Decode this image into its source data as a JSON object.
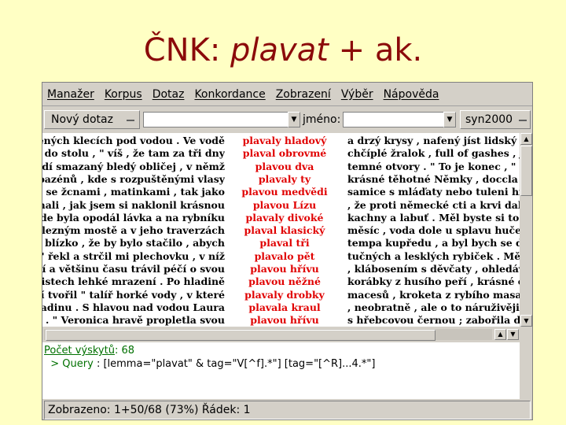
{
  "slide": {
    "title_prefix": "ČNK: ",
    "title_italic": "plavat",
    "title_suffix": " + ak."
  },
  "menubar": {
    "items": [
      "Manažer",
      "Korpus",
      "Dotaz",
      "Konkordance",
      "Zobrazení",
      "Výběr",
      "Nápověda"
    ]
  },
  "toolbar": {
    "new_query_label": "Nový dotaz",
    "query_input_value": "",
    "name_label": "jméno:",
    "name_input_value": "",
    "corpus_label": "syn2000"
  },
  "concordance": {
    "rows": [
      {
        "left": "ěvěných klecích pod vodou . Ve vodě",
        "kwic": "plavaly hladový",
        "right": "a drzý krysy , nafený jíst lidský m"
      },
      {
        "left": "lední do stolu , \" víš , že tam za tři dny",
        "kwic": "plaval obrovmé",
        "right": "chčíplé žralok , full of gashes , jak s"
      },
      {
        "left": "p vidí smazaný bledý obličej , v němž",
        "kwic": "plavou dva",
        "right": "temné otvory . \" To je konec , \" sly"
      },
      {
        "left": "vali bazénů , kde s rozpuštěnými vlasy",
        "kwic": "plavaly ty",
        "right": "krásné těhotné Němky , doccla nat"
      },
      {
        "left": "avali se žcnami , matinkami , tak jako",
        "kwic": "plavou medvědi",
        "right": "samice s mláďaty nebo tuleni hnco"
      },
      {
        "left": "poznali , jak jsem si naklonil krásnou",
        "kwic": "plavou Lízu",
        "right": ", že proti německé cti a krvi dala pi"
      },
      {
        "left": "a , kde byla opodál lávka a na rybníku",
        "kwic": "plavaly divoké",
        "right": "kachny a labuť . Měl byste si to par"
      },
      {
        "left": "a železným mostě a v jeho traverzách",
        "kwic": "plaval klasický",
        "right": "měsíc , voda dole u splavu hučela a"
      },
      {
        "left": "tak blízko , že by bylo stačilo , abych",
        "kwic": "plaval tři",
        "right": "tempa kupředu , a byl bych se dotýl"
      },
      {
        "left": "a \" řekl a strčil mi plechovku , v níž",
        "kwic": "plavalo pět",
        "right": "tučných a lesklých rybiček . Měl jse"
      },
      {
        "left": "eslíví a většinu času trávil péčí o svou",
        "kwic": "plavou hřívu",
        "right": ", klábosením s děvčaty , ohledáván"
      },
      {
        "left": "na pristech lehké mrazení . Po hladině",
        "kwic": "plavou něžné",
        "right": "korábky z husího peří , krásné cize"
      },
      {
        "left": "ení tvořil \" talíř horké vody , v které",
        "kwic": "plavaly drobky",
        "right": "macesů , kroketa z rybího masa , al"
      },
      {
        "left": "u hladinu . S hlavou nad vodou Laura",
        "kwic": "plavala kraul",
        "right": ", neobratně , ale o to náruživěji a s"
      },
      {
        "left": "uhy . \" Veronica hravě propletla svou",
        "kwic": "plavou hřívu",
        "right": "s hřebcovou černou ; zabořila do mi"
      }
    ]
  },
  "log": {
    "count_label": "Počet výskytů",
    "count_value": ": 68",
    "query_prefix": "> Query",
    "query_text": ": [lemma=\"plavat\" & tag=\"V[^f].*\"] [tag=\"[^R]...4.*\"]"
  },
  "status": {
    "text": "Zobrazeno: 1+50/68  (73%)   Řádek: 1"
  },
  "scroll": {
    "horizontal_fraction": 0.87
  }
}
